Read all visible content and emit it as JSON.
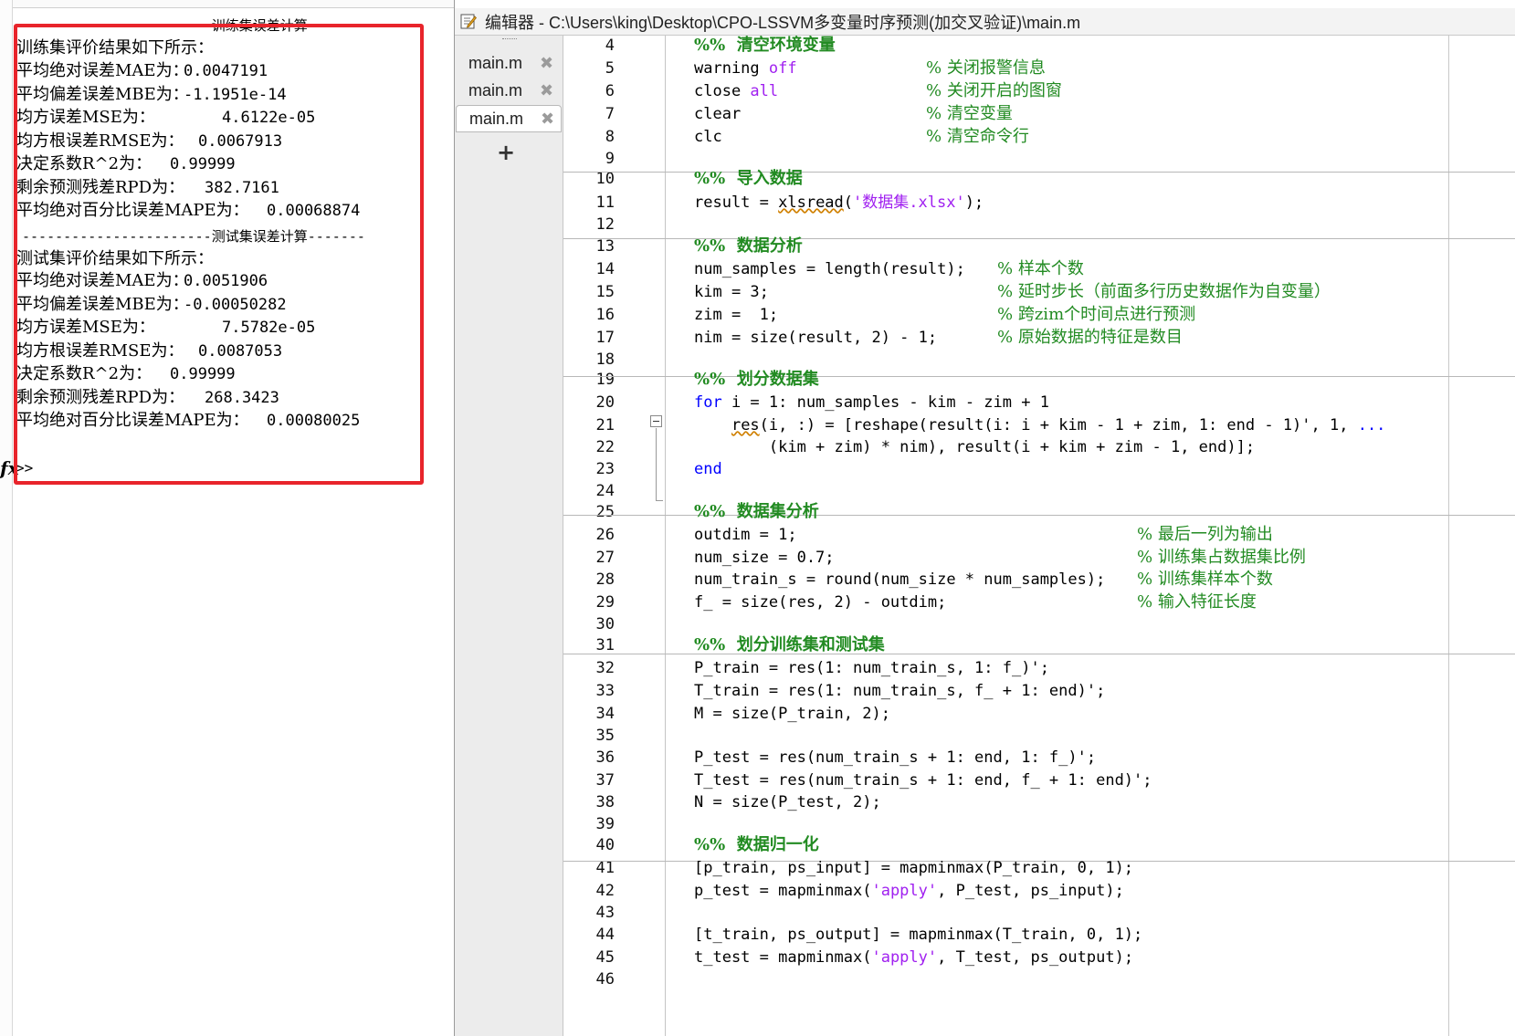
{
  "console": {
    "header_train": "-----------------------训练集误差计算-------",
    "train_title": "训练集评价结果如下所示：",
    "train_rows": [
      {
        "label": "平均绝对误差MAE为：",
        "value": "0.0047191"
      },
      {
        "label": "平均偏差误差MBE为：",
        "value": "-1.1951e-14"
      },
      {
        "label": "均方误差MSE为：",
        "value": "4.6122e-05"
      },
      {
        "label": "均方根误差RMSE为：",
        "value": "0.0067913"
      },
      {
        "label": "决定系数R^2为：",
        "value": "0.99999"
      },
      {
        "label": "剩余预测残差RPD为：",
        "value": "382.7161"
      },
      {
        "label": "平均绝对百分比误差MAPE为：",
        "value": "0.00068874"
      }
    ],
    "header_test": "-----------------------测试集误差计算-------",
    "test_title": "测试集评价结果如下所示：",
    "test_rows": [
      {
        "label": "平均绝对误差MAE为：",
        "value": "0.0051906"
      },
      {
        "label": "平均偏差误差MBE为：",
        "value": "-0.00050282"
      },
      {
        "label": "均方误差MSE为：",
        "value": "7.5782e-05"
      },
      {
        "label": "均方根误差RMSE为：",
        "value": "0.0087053"
      },
      {
        "label": "决定系数R^2为：",
        "value": "0.99999"
      },
      {
        "label": "剩余预测残差RPD为：",
        "value": "268.3423"
      },
      {
        "label": "平均绝对百分比误差MAPE为：",
        "value": "0.00080025"
      }
    ],
    "fx": "fx",
    "prompt": ">>",
    "highlight_color": "#e8242b"
  },
  "editor": {
    "title": "编辑器 - C:\\Users\\king\\Desktop\\CPO-LSSVM多变量时序预测(加交叉验证)\\main.m",
    "tabs": [
      "main.m",
      "main.m",
      "main.m"
    ],
    "tab_close": "✖",
    "add_tab": "+",
    "line_numbers": [
      "4",
      "5",
      "6",
      "7",
      "8",
      "9",
      "10",
      "11",
      "12",
      "13",
      "14",
      "15",
      "16",
      "17",
      "18",
      "19",
      "20",
      "21",
      "22",
      "23",
      "24",
      "25",
      "26",
      "27",
      "28",
      "29",
      "30",
      "31",
      "32",
      "33",
      "34",
      "35",
      "36",
      "37",
      "38",
      "39",
      "40",
      "41",
      "42",
      "43",
      "44",
      "45",
      "46"
    ],
    "code": {
      "l4": "%%  清空环境变量",
      "l5a": "warning ",
      "l5b": "off",
      "l5c": "% 关闭报警信息",
      "l6a": "close ",
      "l6b": "all",
      "l6c": "% 关闭开启的图窗",
      "l7a": "clear",
      "l7c": "% 清空变量",
      "l8a": "clc",
      "l8c": "% 清空命令行",
      "l10": "%%  导入数据",
      "l11a": "result = ",
      "l11b": "xlsread",
      "l11c": "(",
      "l11d": "'数据集.xlsx'",
      "l11e": ");",
      "l13": "%%  数据分析",
      "l14a": "num_samples = length(result);",
      "l14c": "% 样本个数",
      "l15a": "kim = 3;",
      "l15c": "% 延时步长（前面多行历史数据作为自变量）",
      "l16a": "zim =  1;",
      "l16c": "% 跨zim个时间点进行预测",
      "l17a": "nim = size(result, 2) - 1;",
      "l17c": "% 原始数据的特征是数目",
      "l19": "%%  划分数据集",
      "l20a": "for",
      "l20b": " i = 1: num_samples - kim - zim + 1",
      "l21a": "    ",
      "l21b": "res",
      "l21c": "(i, :) = [reshape(result(i: i + kim - 1 + zim, 1: end - 1)', 1, ",
      "l21d": "...",
      "l22": "        (kim + zim) * nim), result(i + kim + zim - 1, end)];",
      "l23": "end",
      "l25": "%%  数据集分析",
      "l26a": "outdim = 1;",
      "l26c": "% 最后一列为输出",
      "l27a": "num_size = 0.7;",
      "l27c": "% 训练集占数据集比例",
      "l28a": "num_train_s = round(num_size * num_samples);",
      "l28c": "% 训练集样本个数",
      "l29a": "f_ = size(res, 2) - outdim;",
      "l29c": "% 输入特征长度",
      "l31": "%%  划分训练集和测试集",
      "l32": "P_train = res(1: num_train_s, 1: f_)';",
      "l33": "T_train = res(1: num_train_s, f_ + 1: end)';",
      "l34": "M = size(P_train, 2);",
      "l36": "P_test = res(num_train_s + 1: end, 1: f_)';",
      "l37": "T_test = res(num_train_s + 1: end, f_ + 1: end)';",
      "l38": "N = size(P_test, 2);",
      "l40": "%%  数据归一化",
      "l41": "[p_train, ps_input] = mapminmax(P_train, 0, 1);",
      "l42a": "p_test = mapminmax(",
      "l42b": "'apply'",
      "l42c": ", P_test, ps_input);",
      "l44": "[t_train, ps_output] = mapminmax(T_train, 0, 1);",
      "l45a": "t_test = mapminmax(",
      "l45b": "'apply'",
      "l45c": ", T_test, ps_output);"
    }
  }
}
